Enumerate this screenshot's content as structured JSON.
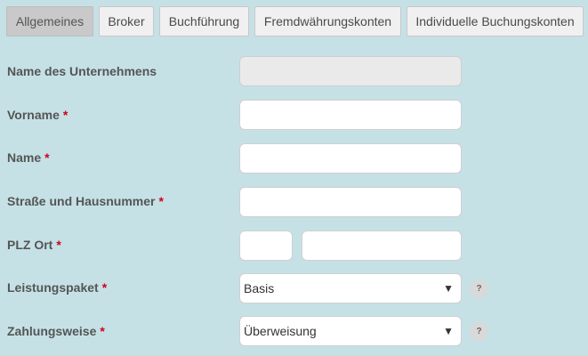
{
  "tabs": [
    {
      "label": "Allgemeines",
      "active": true
    },
    {
      "label": "Broker",
      "active": false
    },
    {
      "label": "Buchführung",
      "active": false
    },
    {
      "label": "Fremdwährungskonten",
      "active": false
    },
    {
      "label": "Individuelle Buchungskonten",
      "active": false
    }
  ],
  "form": {
    "company_name": {
      "label": "Name des Unternehmens",
      "value": "",
      "disabled": true
    },
    "first_name": {
      "label": "Vorname",
      "required_mark": "*",
      "value": ""
    },
    "last_name": {
      "label": "Name",
      "required_mark": "*",
      "value": ""
    },
    "street": {
      "label": "Straße und Hausnummer",
      "required_mark": "*",
      "value": ""
    },
    "zip_city": {
      "label": "PLZ Ort",
      "required_mark": "*",
      "zip_value": "",
      "city_value": ""
    },
    "package": {
      "label": "Leistungspaket",
      "required_mark": "*",
      "selected": "Basis",
      "help": "?"
    },
    "payment": {
      "label": "Zahlungsweise",
      "required_mark": "*",
      "selected": "Überweisung",
      "help": "?"
    }
  },
  "icons": {
    "dropdown_arrow": "▼"
  },
  "colors": {
    "background": "#c5e1e6",
    "required": "#d0021b",
    "tab_active": "#c9c9c9",
    "tab_inactive": "#f0f0f0"
  }
}
